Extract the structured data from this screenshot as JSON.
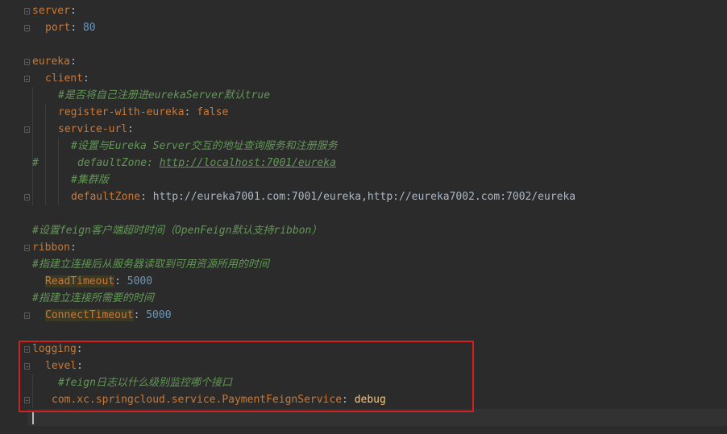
{
  "editor": {
    "language": "yaml",
    "lines": [
      {
        "key": "server",
        "sep": ":"
      },
      {
        "key": "port",
        "sep": ": ",
        "value": "80"
      },
      {},
      {
        "key": "eureka",
        "sep": ":"
      },
      {
        "key": "client",
        "sep": ":"
      },
      {
        "comment": "#是否将自己注册进eurekaServer默认true"
      },
      {
        "key": "register-with-eureka",
        "sep": ": ",
        "value": "false"
      },
      {
        "key": "service-url",
        "sep": ":"
      },
      {
        "comment": "#设置与Eureka Server交互的地址查询服务和注册服务"
      },
      {
        "hash": "#",
        "comment": "defaultZone: ",
        "url": "http://localhost:7001/eureka"
      },
      {
        "comment": "#集群版"
      },
      {
        "key": "defaultZone",
        "sep": ": ",
        "value": "http://eureka7001.com:7001/eureka,http://eureka7002.com:7002/eureka"
      },
      {},
      {
        "comment": "#设置feign客户端超时时间（OpenFeign默认支持ribbon）"
      },
      {
        "key": "ribbon",
        "sep": ":"
      },
      {
        "comment": "#指建立连接后从服务器读取到可用资源所用的时间"
      },
      {
        "key": "ReadTimeout",
        "sep": ": ",
        "value": "5000"
      },
      {
        "comment": "#指建立连接所需要的时间"
      },
      {
        "key": "ConnectTimeout",
        "sep": ": ",
        "value": "5000"
      },
      {},
      {
        "key": "logging",
        "sep": ":"
      },
      {
        "key": "level",
        "sep": ":"
      },
      {
        "comment": "#feign日志以什么级别监控哪个接口"
      },
      {
        "key": "com.xc.springcloud.service.PaymentFeignService",
        "sep": ": ",
        "value": "debug"
      },
      {}
    ]
  },
  "colors": {
    "background": "#2b2b2b",
    "key": "#cc7832",
    "number": "#6897bb",
    "comment": "#629755",
    "highlight_border": "#d41f1f"
  }
}
